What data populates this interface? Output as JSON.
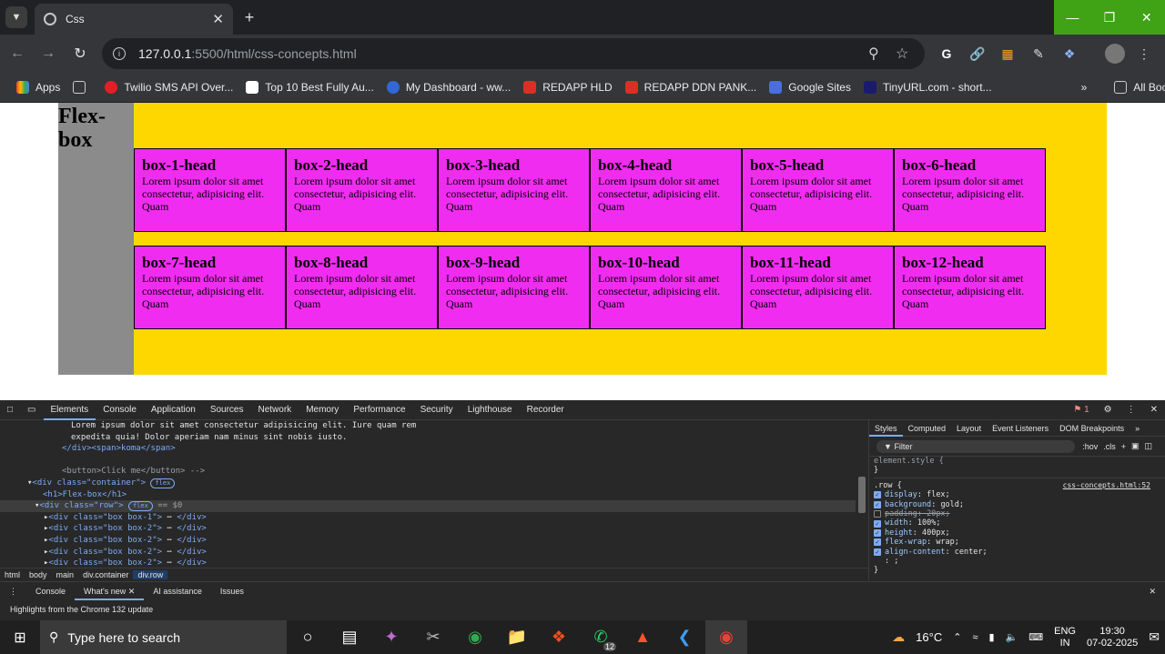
{
  "browser": {
    "tab_title": "Css",
    "url_host": "127.0.0.1",
    "url_path": ":5500/html/css-concepts.html",
    "bookmarks": [
      "Apps",
      "Twilio SMS API Over...",
      "Top 10 Best Fully Au...",
      "My Dashboard - ww...",
      "REDAPP HLD",
      "REDAPP DDN PANK...",
      "Google Sites",
      "TinyURL.com - short..."
    ],
    "all_bookmarks": "All Bookmarks"
  },
  "page": {
    "heading": "Flex-box",
    "boxes": [
      {
        "head": "box-1-head"
      },
      {
        "head": "box-2-head"
      },
      {
        "head": "box-3-head"
      },
      {
        "head": "box-4-head"
      },
      {
        "head": "box-5-head"
      },
      {
        "head": "box-6-head"
      },
      {
        "head": "box-7-head"
      },
      {
        "head": "box-8-head"
      },
      {
        "head": "box-9-head"
      },
      {
        "head": "box-10-head"
      },
      {
        "head": "box-11-head"
      },
      {
        "head": "box-12-head"
      }
    ],
    "box_text": "Lorem ipsum dolor sit amet consectetur, adipisicing elit. Quam",
    "colors": {
      "row": "#ffd700",
      "box": "#f02cf0",
      "heading_bg": "#8b8b8b"
    }
  },
  "devtools": {
    "tabs": [
      "Elements",
      "Console",
      "Application",
      "Sources",
      "Network",
      "Memory",
      "Performance",
      "Security",
      "Lighthouse",
      "Recorder"
    ],
    "issues_count": "1",
    "elements_lines": [
      "Lorem ipsum dolor sit amet consectetur adipisicing elit. Iure quam rem",
      "expedita quia! Dolor aperiam nam minus sint nobis iusto.",
      "</div><span>koma</span>",
      "",
      "<button>Click me</button> -->",
      "<div class=\"container\">",
      "<h1>Flex-box</h1>",
      "<div class=\"row\">",
      "<div class=\"box box-1\">",
      "<div class=\"box box-2\">",
      "<div class=\"box box-2\">",
      "<div class=\"box box-2\">",
      "<div class=\"box box-2\">"
    ],
    "badge_flex": "flex",
    "selected_suffix": "== $0",
    "breadcrumbs": [
      "html",
      "body",
      "main",
      "div.container",
      "div.row"
    ],
    "styles_tabs": [
      "Styles",
      "Computed",
      "Layout",
      "Event Listeners",
      "DOM Breakpoints"
    ],
    "filter_placeholder": "Filter",
    "filter_buttons": [
      ":hov",
      ".cls"
    ],
    "element_style": "element.style {",
    "rule_selector": ".row {",
    "rule_source": "css-concepts.html:52",
    "declarations": [
      {
        "prop": "display",
        "val": "flex;",
        "on": true,
        "struck": false
      },
      {
        "prop": "background",
        "val": "gold;",
        "on": true,
        "struck": false
      },
      {
        "prop": "padding",
        "val": "20px;",
        "on": false,
        "struck": true
      },
      {
        "prop": "width",
        "val": "100%;",
        "on": true,
        "struck": false
      },
      {
        "prop": "height",
        "val": "400px;",
        "on": true,
        "struck": false
      },
      {
        "prop": "flex-wrap",
        "val": "wrap;",
        "on": true,
        "struck": false
      },
      {
        "prop": "align-content",
        "val": "center;",
        "on": true,
        "struck": false
      }
    ],
    "drawer_tabs": [
      "Console",
      "What's new",
      "AI assistance",
      "Issues"
    ],
    "drawer_message": "Highlights from the Chrome 132 update"
  },
  "taskbar": {
    "search_placeholder": "Type here to search",
    "whatsapp_badge": "12",
    "temperature": "16°C",
    "language": "ENG",
    "region": "IN",
    "time": "19:30",
    "date": "07-02-2025"
  }
}
